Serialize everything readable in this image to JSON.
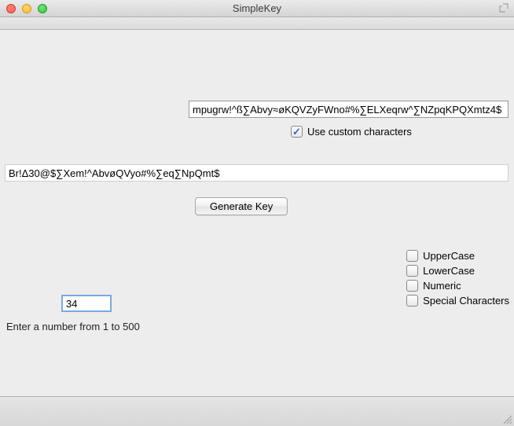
{
  "window": {
    "title": "SimpleKey"
  },
  "customCharsInput": "mpugrw!^ß∑Abvy≈øKQVZyFWno#%∑ELXeqrw^∑NZpqKPQXmtz4$",
  "useCustomChars": {
    "label": "Use custom characters",
    "checked": true
  },
  "keyOutput": "Br!Δ30@$∑Xem!^AbvøQVyo#%∑eq∑NpQmt$",
  "generateLabel": "Generate Key",
  "options": [
    {
      "label": "UpperCase",
      "checked": false
    },
    {
      "label": "LowerCase",
      "checked": false
    },
    {
      "label": "Numeric",
      "checked": false
    },
    {
      "label": "Special Characters",
      "checked": false
    }
  ],
  "numberValue": "34",
  "hint": "Enter a number from 1 to 500"
}
